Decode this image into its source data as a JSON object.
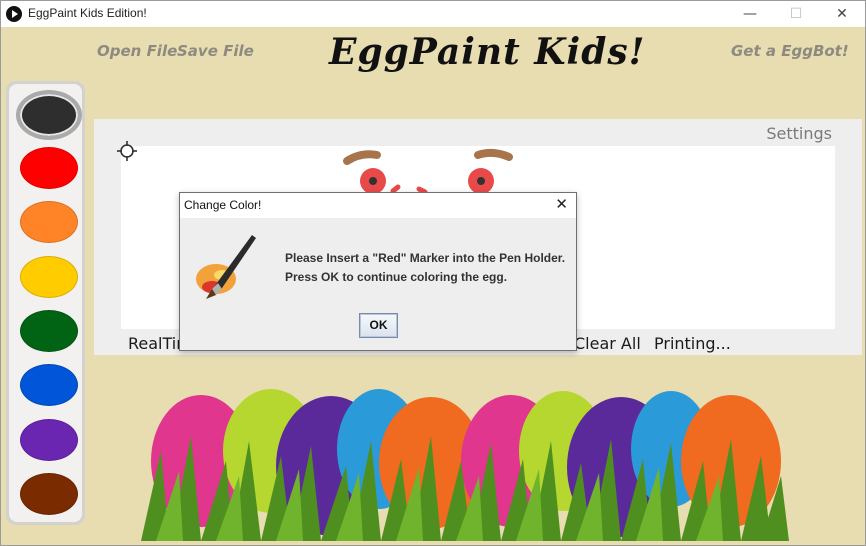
{
  "window": {
    "title": "EggPaint Kids Edition!"
  },
  "header": {
    "open_file": "Open File",
    "save_file": "Save File",
    "logo": "EggPaint Kids!",
    "get_eggbot": "Get a EggBot!"
  },
  "palette": {
    "colors": [
      "#2e2e2e",
      "#ff0000",
      "#ff8427",
      "#ffcc00",
      "#006414",
      "#0055d8",
      "#6a26b0",
      "#7a2b00"
    ],
    "selected_index": 0
  },
  "panel": {
    "settings": "Settings",
    "realtime": "RealTim",
    "clear_all": "Clear All",
    "printing": "Printing..."
  },
  "dialog": {
    "title": "Change Color!",
    "message_line1": "Please Insert a \"Red\" Marker into the Pen Holder.",
    "message_line2": "Press OK to continue coloring the egg.",
    "ok": "OK"
  }
}
